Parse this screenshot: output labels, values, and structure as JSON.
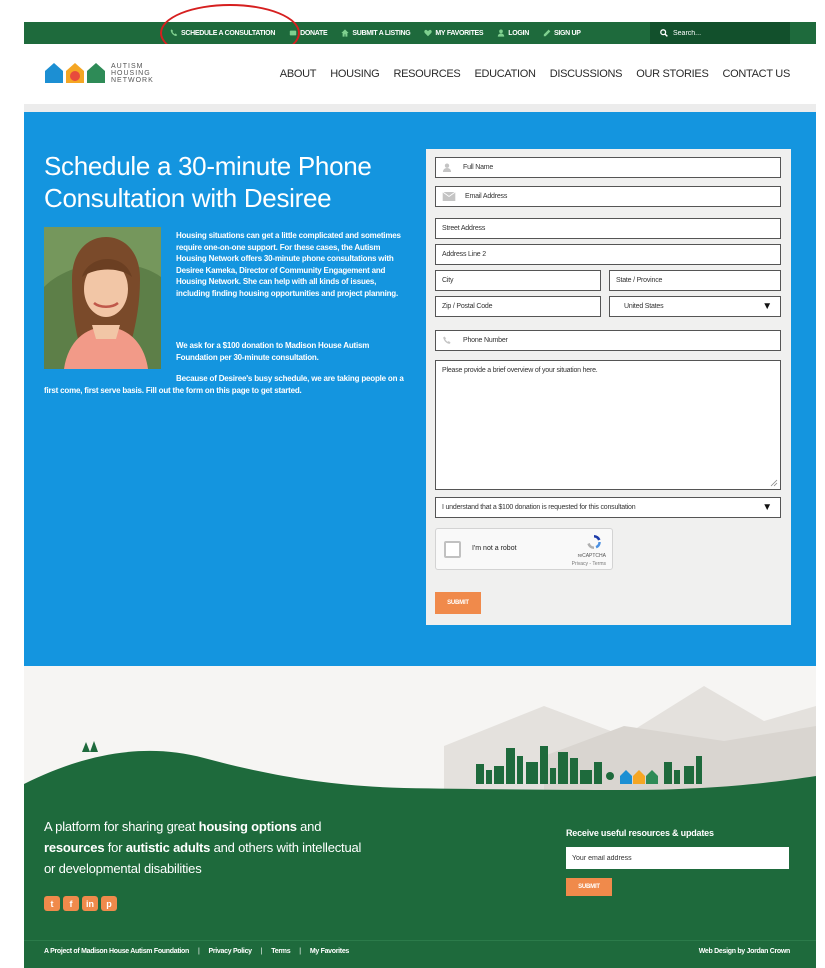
{
  "utility_nav": {
    "items": [
      {
        "label": "SCHEDULE A CONSULTATION",
        "icon": "phone-icon"
      },
      {
        "label": "DONATE",
        "icon": "donate-icon"
      },
      {
        "label": "SUBMIT A LISTING",
        "icon": "house-icon"
      },
      {
        "label": "MY FAVORITES",
        "icon": "heart-icon"
      },
      {
        "label": "LOGIN",
        "icon": "user-icon"
      },
      {
        "label": "SIGN UP",
        "icon": "pencil-icon"
      }
    ],
    "search_placeholder": "Search..."
  },
  "logo": {
    "line1": "AUTISM",
    "line2": "HOUSING",
    "line3": "NETWORK"
  },
  "main_nav": [
    "ABOUT",
    "HOUSING",
    "RESOURCES",
    "EDUCATION",
    "DISCUSSIONS",
    "OUR STORIES",
    "CONTACT US"
  ],
  "hero": {
    "title": "Schedule a 30-minute Phone Consultation with Desiree",
    "intro": "Housing situations can get a little complicated and sometimes require one-on-one support. For these cases, the Autism Housing Network offers 30-minute phone consultations with Desiree Kameka, Director of Community Engagement and Housing Network. She can help with all kinds of issues, including finding housing opportunities and project planning.",
    "donation": "We ask for a $100 donation to Madison House Autism Foundation per 30-minute consultation.",
    "busy": "Because of Desiree's busy schedule, we are taking people on a first come, first serve basis. Fill out the form on this page to get started."
  },
  "form": {
    "full_name": "Full Name",
    "email": "Email Address",
    "street": "Street Address",
    "address2": "Address Line 2",
    "city": "City",
    "state": "State / Province",
    "zip": "Zip / Postal Code",
    "country": "United States",
    "phone": "Phone Number",
    "overview": "Please provide a brief overview of your situation here.",
    "agreement": "I understand that a $100 donation is requested for this consultation",
    "recaptcha_label": "I'm not a robot",
    "recaptcha_brand": "reCAPTCHA",
    "recaptcha_terms": "Privacy - Terms",
    "submit": "SUBMIT"
  },
  "footer": {
    "tagline_1": "A platform for sharing great ",
    "tagline_2": "housing options",
    "tagline_3": " and ",
    "tagline_4": "resources",
    "tagline_5": " for ",
    "tagline_6": "autistic adults",
    "tagline_7": " and others with intellectual or developmental disabilities",
    "newsletter_title": "Receive useful resources & updates",
    "newsletter_placeholder": "Your email address",
    "newsletter_submit": "SUBMIT",
    "social": [
      "twitter-icon",
      "facebook-icon",
      "linkedin-icon",
      "pinterest-icon"
    ],
    "legal": [
      "A Project of Madison House Autism Foundation",
      "Privacy Policy",
      "Terms",
      "My Favorites"
    ],
    "credit": "Web Design by Jordan Crown"
  },
  "colors": {
    "green": "#1e6a3c",
    "blue": "#1495df",
    "orange": "#f08a4b",
    "annotation_red": "#d61f1f"
  }
}
